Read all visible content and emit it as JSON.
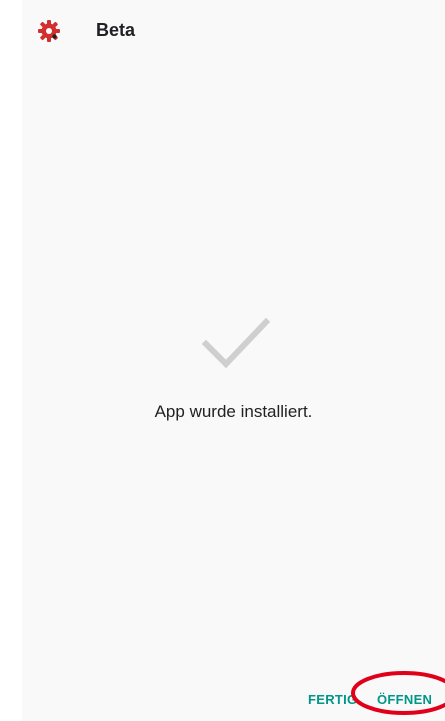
{
  "header": {
    "app_name": "Beta",
    "app_icon": "red-gear-icon"
  },
  "main": {
    "status_icon": "checkmark-icon",
    "status_text": "App wurde installiert."
  },
  "actions": {
    "done_label": "FERTIG",
    "open_label": "ÖFFNEN"
  },
  "colors": {
    "accent": "#009688",
    "brand_red": "#d32f2f",
    "check": "#cfcfcf",
    "annotation": "#e0001a"
  }
}
